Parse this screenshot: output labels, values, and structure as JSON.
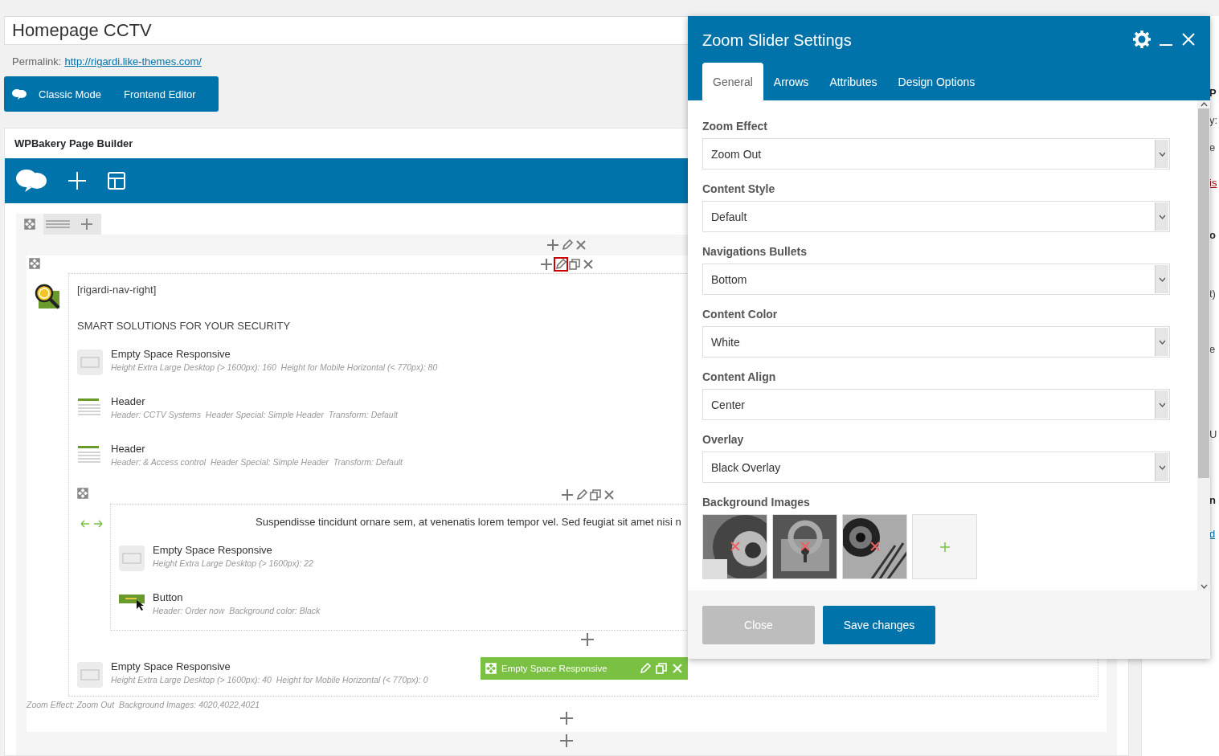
{
  "title_field": {
    "value": "Homepage CCTV"
  },
  "permalink": {
    "label": "Permalink:",
    "url": "http://rigardi.like-themes.com/"
  },
  "mode_buttons": [
    {
      "label": "Classic Mode"
    },
    {
      "label": "Frontend Editor"
    }
  ],
  "builder": {
    "title": "WPBakery Page Builder",
    "column": {
      "edit_highlighted": true,
      "shortcode": "[rigardi-nav-right]",
      "heading": "SMART SOLUTIONS FOR YOUR SECURITY",
      "items": [
        {
          "kind": "space",
          "name": "Empty Space Responsive",
          "params": "Height Extra Large Desktop (> 1600px): 160  Height for Mobile Horizontal (< 770px): 80"
        },
        {
          "kind": "header",
          "name": "Header",
          "params": "Header: CCTV Systems  Header Special: Simple Header  Transform: Default"
        },
        {
          "kind": "header",
          "name": "Header",
          "params": "Header: & Access control  Header Special: Simple Header  Transform: Default"
        }
      ],
      "inner_row": {
        "text": "Suspendisse tincidunt ornare sem, at venenatis lorem tempor vel. Sed feugiat sit amet nisi n",
        "items": [
          {
            "kind": "space",
            "name": "Empty Space Responsive",
            "params": "Height Extra Large Desktop (> 1600px): 22"
          },
          {
            "kind": "button",
            "name": "Button",
            "params": "Header: Order now  Background color: Black"
          }
        ]
      },
      "after_items": [
        {
          "kind": "space",
          "name": "Empty Space Responsive",
          "params": "Height Extra Large Desktop (> 1600px): 40  Height for Mobile Horizontal (< 770px): 0",
          "hover_toolbar": "Empty Space Responsive"
        }
      ]
    },
    "summary": "Zoom Effect: Zoom Out  Background Images: 4020,4022,4021"
  },
  "modal": {
    "title": "Zoom Slider Settings",
    "tabs": [
      {
        "label": "General",
        "selected": true
      },
      {
        "label": "Arrows",
        "selected": false
      },
      {
        "label": "Attributes",
        "selected": false
      },
      {
        "label": "Design Options",
        "selected": false
      }
    ],
    "fields": [
      {
        "label": "Zoom Effect",
        "value": "Zoom Out"
      },
      {
        "label": "Content Style",
        "value": "Default"
      },
      {
        "label": "Navigations Bullets",
        "value": "Bottom"
      },
      {
        "label": "Content Color",
        "value": "White"
      },
      {
        "label": "Content Align",
        "value": "Center"
      },
      {
        "label": "Overlay",
        "value": "Black Overlay"
      }
    ],
    "images": {
      "label": "Background Images"
    },
    "buttons": [
      {
        "label": "Close",
        "kind": "secondary"
      },
      {
        "label": "Save changes",
        "kind": "primary"
      }
    ]
  },
  "sidebar_fragments": [
    {
      "text": "P",
      "kind": "bold"
    },
    {
      "text": "y:",
      "kind": "text"
    },
    {
      "text": "e",
      "kind": "text"
    },
    {
      "text": "is",
      "kind": "danger_link"
    },
    {
      "text": "o",
      "kind": "bold"
    },
    {
      "text": "t)",
      "kind": "text"
    },
    {
      "text": "e",
      "kind": "text"
    },
    {
      "text": "U",
      "kind": "text"
    },
    {
      "text": "n",
      "kind": "bold"
    },
    {
      "text": "d",
      "kind": "link"
    }
  ]
}
